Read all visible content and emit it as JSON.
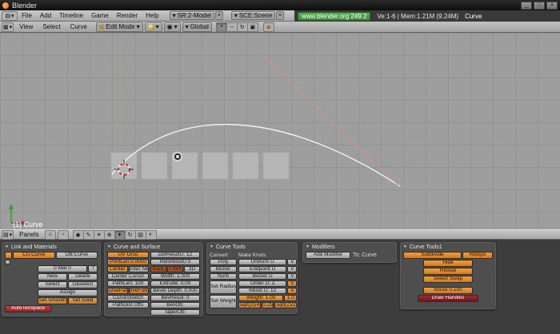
{
  "window": {
    "title": "Blender",
    "controls": [
      "_",
      "□",
      "×"
    ]
  },
  "colors": {
    "accent_orange": "#cd8033",
    "alert_red": "#b22222",
    "badge_green": "#4a9a4a",
    "grid_bg": "#9e9e9e",
    "curve_white": "#f2f2f2",
    "handle_pink": "#d4908f"
  },
  "icons": {
    "tri": "▼",
    "drop": "▾",
    "menu": "▤",
    "grid": "▦",
    "close": "×",
    "mode": "▣",
    "pivot": "◉",
    "hand": "+",
    "move": "↔",
    "rotate": "↻",
    "scale": "▣",
    "prop": "◉",
    "home": "⌂",
    "square": "▫",
    "help": "?",
    "ctx": [
      "◉",
      "✎",
      "☀",
      "⊕",
      "✦",
      "↻",
      "▤",
      "◐"
    ]
  },
  "info_header": {
    "menus": [
      "File",
      "Add",
      "Timeline",
      "Game",
      "Render",
      "Help"
    ],
    "screen_selector": "SR:2-Model",
    "scene_selector": "SCE:Scene",
    "version_badge": "www.blender.org 249.2",
    "stats": "Ve:1-6 | Mem:1.21M (9.24M)",
    "active_object": "Curve"
  },
  "viewport_header": {
    "menus": [
      "View",
      "Select",
      "Curve"
    ],
    "mode": "Edit Mode",
    "orientation": "Global"
  },
  "viewport": {
    "label": "(1) Curve"
  },
  "buttons_header": {
    "panels_label": "Panels"
  },
  "panels": {
    "link_and_materials": {
      "title": "Link and Materials",
      "cu_field": "CU:Curve",
      "ob_field": "OB:Curve",
      "mat_count": "0 Mat 0",
      "mat_menu": "?",
      "new": "New",
      "delete": "Delete",
      "select": "Select",
      "deselect": "Deselect",
      "assign": "Assign",
      "set_smooth": "Set Smooth",
      "set_solid": "Set Solid",
      "autotexspace": "AutoTexSpace"
    },
    "curve_and_surface": {
      "title": "Curve and Surface",
      "uv_orco": "UV Orco",
      "printlen": "PrintLen 0.0000",
      "center": "Center",
      "center_new": "Center New",
      "center_cursor": "Center Cursor",
      "pathlen": "PathLen: 100",
      "curvepath": "CurvePath",
      "curvefollow": "CurveFollow",
      "curvestretch": "CurveStretch",
      "pathdist_offs": "PathDist Offs",
      "defresolu": "DefResolU: 12",
      "renresolu": "RenResolU 0",
      "back": "Back",
      "front": "Front",
      "threed": "3D",
      "width": "Width: 1.000",
      "extrude": "Extrude: 0.00",
      "bevel_depth": "Bevel Depth: 0.000",
      "bevresol": "BevResol: 0",
      "bevob": "BevOb:",
      "taperob": "TaperOb:"
    },
    "curve_tools": {
      "title": "Curve Tools",
      "convert_label": "Convert",
      "make_knots_label": "Make Knots",
      "poly": "Poly",
      "bezier": "Bezier",
      "nurb": "Nurb",
      "uniform_u": "Uniform U",
      "endpoint_u": "Endpoint U",
      "bezier_u": "Bezier U",
      "v": "V",
      "set_radius": "Set Radius",
      "order_u": "Order U: 2",
      "resol_u": "Resol U: 12",
      "set_weight": "Set Weight",
      "weight": "Weight: 1.00",
      "w1": "1.0",
      "w2": "sqrt(2)/4",
      "w3": "0.25",
      "w4": "sqrt(2)/2"
    },
    "modifiers": {
      "title": "Modifiers",
      "add_modifier": "Add Modifier",
      "to_label": "To: Curve"
    },
    "curve_tools1": {
      "title": "Curve Tools1",
      "subdivide": "Subdivide",
      "retopo": "Retopo",
      "hide": "Hide",
      "reveal": "Reveal",
      "select_swap": "Select Swap",
      "nsize": "NSize 0.100",
      "draw_handles": "Draw Handles"
    }
  }
}
